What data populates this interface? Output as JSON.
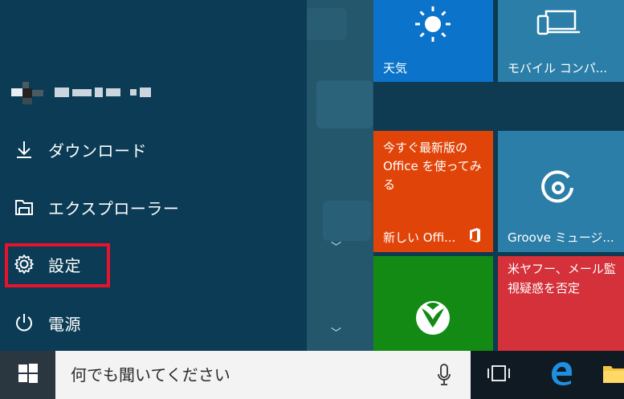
{
  "user": {
    "name_redacted": true
  },
  "menu": {
    "items": [
      {
        "label": "ダウンロード",
        "icon": "download-icon"
      },
      {
        "label": "エクスプローラー",
        "icon": "folder-icon"
      },
      {
        "label": "設定",
        "icon": "gear-icon"
      },
      {
        "label": "電源",
        "icon": "power-icon"
      }
    ]
  },
  "tiles": {
    "weather": {
      "label": "天気",
      "color": "#0b73c9"
    },
    "mobile": {
      "label": "モバイル コンパ...",
      "color": "#2b7ea7"
    },
    "office": {
      "line1": "今すぐ最新版の",
      "line2": "Office を使ってみ",
      "line3": "る",
      "footer": "新しい Offi...",
      "color": "#e14408"
    },
    "groove": {
      "label": "Groove ミュージ...",
      "color": "#2b7ea7"
    },
    "xbox": {
      "color": "#128a14"
    },
    "news": {
      "line1": "米ヤフー、メール監",
      "line2": "視疑惑を否定",
      "color": "#d4313a"
    }
  },
  "taskbar": {
    "search_placeholder": "何でも聞いてください"
  },
  "colors": {
    "highlight": "#e8132a",
    "menu_bg": "#0b3b55",
    "taskbar_bg": "#101a22"
  }
}
